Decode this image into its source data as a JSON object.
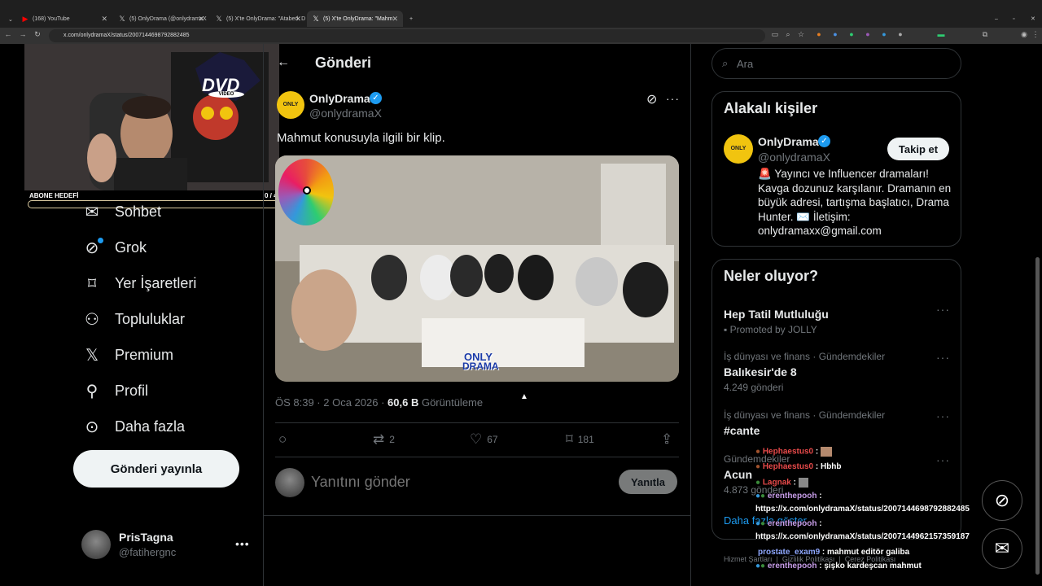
{
  "browser": {
    "tabs": [
      {
        "label": "(168) YouTube",
        "icon": "youtube-icon"
      },
      {
        "label": "(5) OnlyDrama (@onlydramaX",
        "icon": "x-icon"
      },
      {
        "label": "(5) X'te OnlyDrama: \"Ataberk D",
        "icon": "x-icon"
      },
      {
        "label": "(5) X'te OnlyDrama: \"Mahm",
        "icon": "x-icon"
      }
    ],
    "url": "x.com/onlydramaX/status/2007144698792882485"
  },
  "stream": {
    "dvd_logo": "DVD",
    "dvd_sub": "VIDEO",
    "goal_label": "ABONE HEDEFİ",
    "goal_value": "0 / 4"
  },
  "sidebar": {
    "items": [
      {
        "label": "Sohbet",
        "icon": "mail-icon"
      },
      {
        "label": "Grok",
        "icon": "grok-icon"
      },
      {
        "label": "Yer İşaretleri",
        "icon": "bookmark-icon"
      },
      {
        "label": "Topluluklar",
        "icon": "communities-icon"
      },
      {
        "label": "Premium",
        "icon": "x-logo-icon"
      },
      {
        "label": "Profil",
        "icon": "person-icon"
      },
      {
        "label": "Daha fazla",
        "icon": "more-circle-icon"
      }
    ],
    "post_button": "Gönderi yayınla",
    "account": {
      "name": "PrisTagna",
      "handle": "@fatihergnc"
    }
  },
  "main": {
    "header_title": "Gönderi",
    "author": {
      "name": "OnlyDrama",
      "handle": "@onlydramaX",
      "verified": true
    },
    "text": "Mahmut konusuyla ilgili bir klip.",
    "video_watermark_1": "ONLY",
    "video_watermark_2": "DRAMA",
    "meta": {
      "time": "ÖS 8:39 · 2 Oca 2026 · ",
      "views_count": "60,6 B",
      "views_label": " Görüntüleme"
    },
    "actions": {
      "replies": "",
      "reposts": "2",
      "likes": "67",
      "bookmarks": "181"
    },
    "reply": {
      "placeholder": "Yanıtını gönder",
      "button": "Yanıtla"
    }
  },
  "right": {
    "search_placeholder": "Ara",
    "related_title": "Alakalı kişiler",
    "related": {
      "name": "OnlyDrama",
      "handle": "@onlydramaX",
      "follow": "Takip et",
      "bio": "🚨 Yayıncı ve Influencer dramaları! Kavga dozunuz karşılanır. Dramanın en büyük adresi, tartışma başlatıcı, Drama Hunter. ✉️ İletişim: onlydramaxx@gmail.com"
    },
    "trends_title": "Neler oluyor?",
    "trends": [
      {
        "cat": "",
        "name": "Hep Tatil Mutluluğu",
        "count": "Promoted by JOLLY"
      },
      {
        "cat": "İş dünyası ve finans · Gündemdekiler",
        "name": "Balıkesir'de 8",
        "count": "4.249 gönderi"
      },
      {
        "cat": "İş dünyası ve finans · Gündemdekiler",
        "name": "#cante",
        "count": ""
      },
      {
        "cat": "Gündemdekiler",
        "name": "Acun",
        "count": "4.873 gönderi"
      }
    ],
    "show_more": "Daha fazla göster",
    "footer": [
      "Hizmet Şartları",
      "Gizlilik Politikası",
      "Çerez Politikası"
    ]
  },
  "chat": [
    {
      "user": "Hephaestus0",
      "msg": ""
    },
    {
      "user": "Hephaestus0",
      "msg": "Hbhb"
    },
    {
      "user": "Lagnak",
      "msg": ""
    },
    {
      "user": "erenthepooh",
      "msg": "https://x.com/onlydramaX/status/2007144698792882485"
    },
    {
      "user": "erenthepooh",
      "msg": "https://x.com/onlydramaX/status/2007144962157359187"
    },
    {
      "user": "prostate_exam9",
      "msg": "mahmut editör galiba"
    },
    {
      "user": "erenthepooh",
      "msg": "şişko kardeşcan mahmut"
    }
  ],
  "colors": {
    "accent": "#1d9bf0",
    "bg": "#000000",
    "border": "#2f3336",
    "muted": "#71767b"
  }
}
